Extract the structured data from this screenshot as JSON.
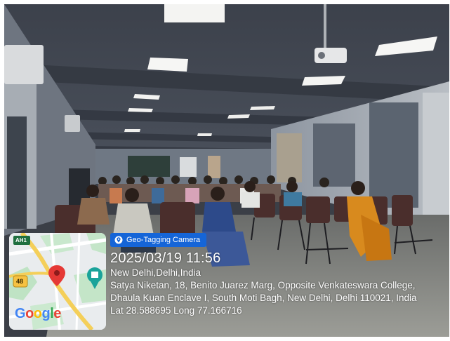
{
  "photo": {
    "subject": "seminar-hall-audience"
  },
  "map": {
    "road_label_1": "AH1",
    "road_label_2": "48",
    "logo_parts": [
      "G",
      "o",
      "o",
      "g",
      "l",
      "e"
    ],
    "logo_colors": [
      "#4285F4",
      "#EA4335",
      "#FBBC05",
      "#4285F4",
      "#34A853",
      "#EA4335"
    ],
    "marker_color": "#e53935",
    "poi_color": "#1aa39a"
  },
  "badge": {
    "label": "Geo-Tagging Camera",
    "color": "#1565d8"
  },
  "stamp": {
    "datetime": "2025/03/19 11:56",
    "place": "New Delhi,Delhi,India",
    "address_line1": "Satya Niketan, 18, Benito Juarez Marg, Opposite Venkateswara College,",
    "address_line2": "Dhaula Kuan Enclave I, South Moti Bagh, New Delhi, Delhi 110021, India",
    "coords": "Lat 28.588695 Long 77.166716"
  }
}
